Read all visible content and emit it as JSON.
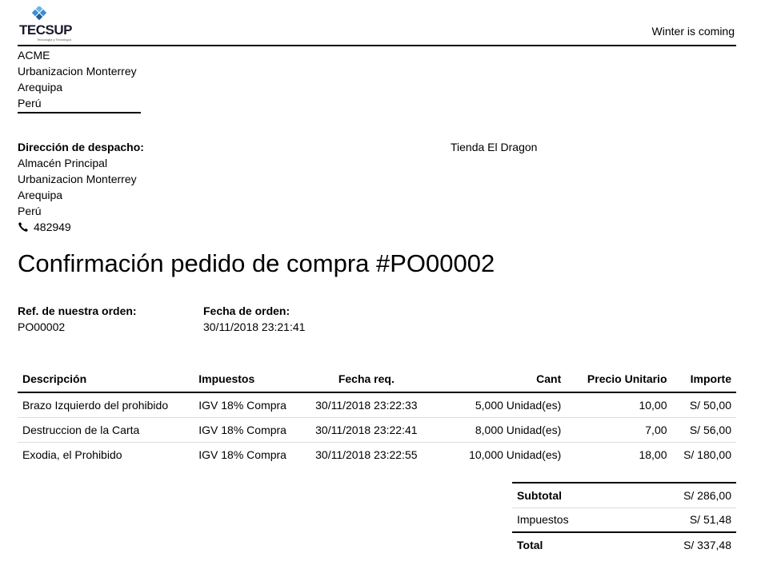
{
  "header": {
    "logo_text": "TECSUP",
    "logo_subtitle": "Tecnología y Tecnología",
    "slogan": "Winter is coming"
  },
  "company": {
    "name": "ACME",
    "street": "Urbanizacion Monterrey",
    "city": "Arequipa",
    "country": "Perú"
  },
  "shipping": {
    "label": "Dirección de despacho:",
    "name": "Almacén Principal",
    "street": "Urbanizacion Monterrey",
    "city": "Arequipa",
    "country": "Perú",
    "phone": "482949",
    "phone_icon": "phone-icon"
  },
  "vendor": {
    "name": "Tienda El Dragon"
  },
  "title": "Confirmación pedido de compra #PO00002",
  "info": {
    "ref_label": "Ref. de nuestra orden:",
    "ref_value": "PO00002",
    "date_label": "Fecha de orden:",
    "date_value": "30/11/2018 23:21:41"
  },
  "table": {
    "headers": [
      "Descripción",
      "Impuestos",
      "Fecha req.",
      "Cant",
      "Precio Unitario",
      "Importe"
    ],
    "rows": [
      [
        "Brazo Izquierdo del prohibido",
        "IGV 18% Compra",
        "30/11/2018 23:22:33",
        "5,000 Unidad(es)",
        "10,00",
        "S/ 50,00"
      ],
      [
        "Destruccion de la Carta",
        "IGV 18% Compra",
        "30/11/2018 23:22:41",
        "8,000 Unidad(es)",
        "7,00",
        "S/ 56,00"
      ],
      [
        "Exodia, el Prohibido",
        "IGV 18% Compra",
        "30/11/2018 23:22:55",
        "10,000 Unidad(es)",
        "18,00",
        "S/ 180,00"
      ]
    ]
  },
  "totals": {
    "subtotal_label": "Subtotal",
    "subtotal_value": "S/ 286,00",
    "tax_label": "Impuestos",
    "tax_value": "S/ 51,48",
    "total_label": "Total",
    "total_value": "S/ 337,48"
  },
  "colors": {
    "logo_blue": "#3b8fd0",
    "logo_dark": "#1a1a2e"
  }
}
